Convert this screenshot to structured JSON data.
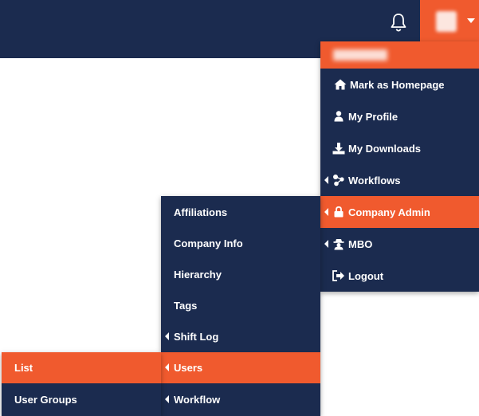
{
  "header": {
    "bell_icon": "bell-icon",
    "user_menu_caret": "caret-down-icon"
  },
  "user_menu": {
    "items": [
      {
        "label": "Mark as Homepage",
        "icon": "home-icon"
      },
      {
        "label": "My Profile",
        "icon": "user-icon"
      },
      {
        "label": "My Downloads",
        "icon": "download-icon"
      },
      {
        "label": "Workflows",
        "icon": "workflow-icon",
        "submenu": true
      },
      {
        "label": "Company Admin",
        "icon": "lock-icon",
        "submenu": true,
        "active": true
      },
      {
        "label": "MBO",
        "icon": "spy-icon",
        "submenu": true
      },
      {
        "label": "Logout",
        "icon": "logout-icon"
      }
    ]
  },
  "company_admin_menu": {
    "items": [
      {
        "label": "Affiliations"
      },
      {
        "label": "Company Info"
      },
      {
        "label": "Hierarchy"
      },
      {
        "label": "Tags"
      },
      {
        "label": "Shift Log",
        "submenu": true
      },
      {
        "label": "Users",
        "submenu": true,
        "active": true
      },
      {
        "label": "Workflow",
        "submenu": true
      }
    ]
  },
  "users_menu": {
    "items": [
      {
        "label": "List",
        "active": true
      },
      {
        "label": "User Groups"
      }
    ]
  },
  "colors": {
    "navy": "#1b2b4f",
    "accent": "#f05a2e",
    "text": "#ffffff"
  }
}
